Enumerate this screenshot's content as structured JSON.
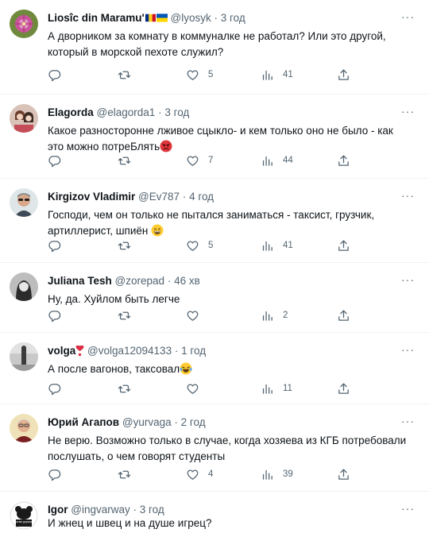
{
  "tweets": [
    {
      "name": "Liosîc din Maramu'",
      "handle": "@lyosyk",
      "time": "3 год",
      "text": "А дворником за комнату в коммуналке не работал? Или это другой, который в морской пехоте служил?",
      "likes": "5",
      "views": "41",
      "flags": [
        "romania-flag",
        "ukraine-flag"
      ]
    },
    {
      "name": "Elagorda",
      "handle": "@elagorda1",
      "time": "3 год",
      "text": "Какое разносторонне лживое сцыкло- и кем только оно не было - как это можно потреБлять",
      "emoji": "angry-face-emoji",
      "likes": "7",
      "views": "44"
    },
    {
      "name": "Kirgizov Vladimir",
      "handle": "@Ev787",
      "time": "4 год",
      "text": "Господи, чем он только не пытался заниматься - таксист, грузчик, артиллерист, шпиён",
      "emoji": "grinning-face-emoji",
      "likes": "5",
      "views": "41"
    },
    {
      "name": "Juliana Tesh",
      "handle": "@zorepad",
      "time": "46 хв",
      "text": "Ну, да. Хуйлом быть легче",
      "likes": "",
      "views": "2"
    },
    {
      "name": "volga",
      "handle": "@volga12094133",
      "time": "1 год",
      "text": "А после вагонов, таксовал",
      "emoji": "crying-laughing-emoji",
      "name_emoji": "heart-exclamation-emoji",
      "likes": "",
      "views": "11"
    },
    {
      "name": "Юрий Агапов",
      "handle": "@yurvaga",
      "time": "2 год",
      "text": "Не верю. Возможно только в случае, когда хозяева из КГБ потребовали послушать, о чем говорят студенты",
      "likes": "4",
      "views": "39"
    },
    {
      "name": "Igor",
      "handle": "@ingvarway",
      "time": "3 год",
      "text": "И жнец и швец и на душе игрец?",
      "avatar_text": "осатаю дорешил",
      "likes": "",
      "views": ""
    }
  ],
  "separator": "·",
  "more_label": "···",
  "colors": {
    "text": "#0f1419",
    "secondary": "#536471",
    "divider": "#eff3f4"
  }
}
